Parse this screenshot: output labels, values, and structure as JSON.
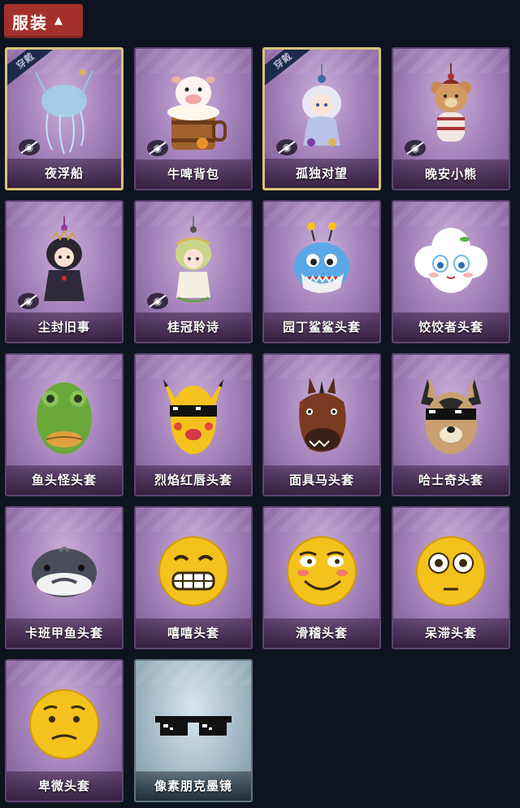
{
  "header": {
    "title": "服装",
    "chevron_icon": "chevron-up-icon",
    "color": "#a3302b"
  },
  "badge_text": "穿戴",
  "items": [
    {
      "label": "夜浮船",
      "equipped": true,
      "hidden": true,
      "icon": "jellyfish-pendant-icon"
    },
    {
      "label": "牛啤背包",
      "equipped": false,
      "hidden": true,
      "icon": "cow-barrel-icon"
    },
    {
      "label": "孤独对望",
      "equipped": true,
      "hidden": true,
      "icon": "doll-pendant-icon"
    },
    {
      "label": "晚安小熊",
      "equipped": false,
      "hidden": true,
      "icon": "bear-pendant-icon"
    },
    {
      "label": "尘封旧事",
      "equipped": false,
      "hidden": true,
      "icon": "dark-doll-pendant-icon"
    },
    {
      "label": "桂冠聆诗",
      "equipped": false,
      "hidden": true,
      "icon": "laurel-doll-pendant-icon"
    },
    {
      "label": "园丁鲨鲨头套",
      "equipped": false,
      "hidden": false,
      "icon": "shark-head-icon"
    },
    {
      "label": "饺饺者头套",
      "equipped": false,
      "hidden": false,
      "icon": "cloud-face-head-icon"
    },
    {
      "label": "鱼头怪头套",
      "equipped": false,
      "hidden": false,
      "icon": "fish-head-icon"
    },
    {
      "label": "烈焰红唇头套",
      "equipped": false,
      "hidden": false,
      "icon": "yellow-mask-head-icon"
    },
    {
      "label": "面具马头套",
      "equipped": false,
      "hidden": false,
      "icon": "horse-head-icon"
    },
    {
      "label": "哈士奇头套",
      "equipped": false,
      "hidden": false,
      "icon": "husky-head-icon"
    },
    {
      "label": "卡班甲鱼头套",
      "equipped": false,
      "hidden": false,
      "icon": "whale-head-icon"
    },
    {
      "label": "嘻嘻头套",
      "equipped": false,
      "hidden": false,
      "icon": "grin-emoji-icon"
    },
    {
      "label": "滑稽头套",
      "equipped": false,
      "hidden": false,
      "icon": "smirk-emoji-icon"
    },
    {
      "label": "呆滞头套",
      "equipped": false,
      "hidden": false,
      "icon": "stare-emoji-icon"
    },
    {
      "label": "卑微头套",
      "equipped": false,
      "hidden": false,
      "icon": "humble-emoji-icon"
    },
    {
      "label": "像素朋克墨镜",
      "equipped": false,
      "hidden": false,
      "icon": "pixel-sunglasses-icon",
      "frost": true
    }
  ]
}
